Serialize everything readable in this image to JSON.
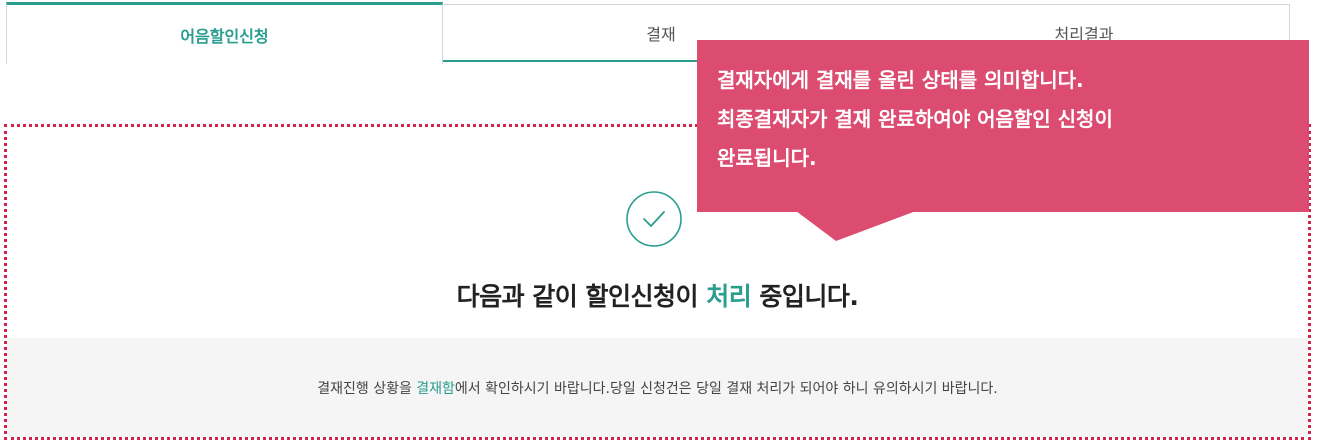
{
  "tabs": [
    {
      "label": "어음할인신청"
    },
    {
      "label": "결재"
    },
    {
      "label": "처리결과"
    }
  ],
  "result": {
    "headline_prefix": "다음과 같이 할인신청이 ",
    "headline_accent": "처리",
    "headline_suffix": " 중입니다.",
    "notice_prefix": "결재진행 상황을 ",
    "notice_link": "결재함",
    "notice_suffix": "에서 확인하시기 바랍니다.당일 신청건은 당일 결재 처리가 되어야 하니 유의하시기 바랍니다."
  },
  "tooltip": {
    "lines": [
      "결재자에게 결재를 올린 상태를 의미합니다.",
      "최종결재자가 결재 완료하여야 어음할인 신청이",
      "완료됩니다."
    ]
  },
  "colors": {
    "accent": "#2a9d8f",
    "tooltip": "#dc4b70",
    "highlight_border": "#d0254a"
  },
  "icons": {
    "status": "check-circle-icon"
  }
}
